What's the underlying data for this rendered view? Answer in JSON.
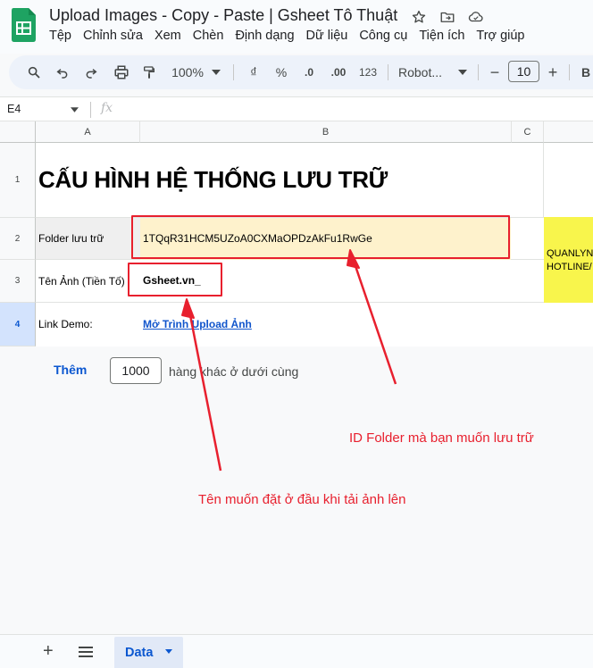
{
  "window": {
    "title": "Upload Images - Copy - Paste | Gsheet Tô Thuật",
    "title_icons": [
      "star-icon",
      "move-to-folder-icon",
      "cloud-saved-icon"
    ]
  },
  "menu": {
    "items": [
      "Tệp",
      "Chỉnh sửa",
      "Xem",
      "Chèn",
      "Định dạng",
      "Dữ liệu",
      "Công cụ",
      "Tiện ích",
      "Trợ giúp"
    ]
  },
  "toolbar": {
    "zoom": "100%",
    "currency": "₫",
    "percent": "%",
    "decrease_decimal": ".0",
    "increase_decimal": ".00",
    "number_format": "123",
    "font": "Robot...",
    "font_size": "10",
    "minus": "−",
    "plus": "+",
    "bold": "B"
  },
  "formula_bar": {
    "name_box": "E4",
    "fx": "fx"
  },
  "grid": {
    "columns": [
      "A",
      "B",
      "C"
    ],
    "rows": [
      "1",
      "2",
      "3",
      "4"
    ],
    "selected_row": "4",
    "title": "CẤU HÌNH HỆ THỐNG LƯU TRỮ",
    "folder_label": "Folder lưu trữ",
    "folder_id": "1TQqR31HCM5UZoA0CXMaOPDzAkFu1RwGe",
    "prefix_label": "Tên Ảnh (Tiền Tố)",
    "prefix_value": "Gsheet.vn_",
    "demo_label": "Link Demo:",
    "demo_link": "Mở Trình Upload Ảnh",
    "side_text_1": "QUANLYN",
    "side_text_2": "HOTLINE/",
    "side_color": "#f8f54c"
  },
  "add_rows": {
    "button": "Thêm",
    "count": "1000",
    "suffix": "hàng khác ở dưới cùng"
  },
  "annotations": {
    "folder_note": "ID Folder mà bạn muốn lưu trữ",
    "prefix_note": "Tên muốn đặt ở đầu khi tải ảnh lên",
    "color": "#e8202e"
  },
  "sheets": {
    "active": "Data"
  }
}
